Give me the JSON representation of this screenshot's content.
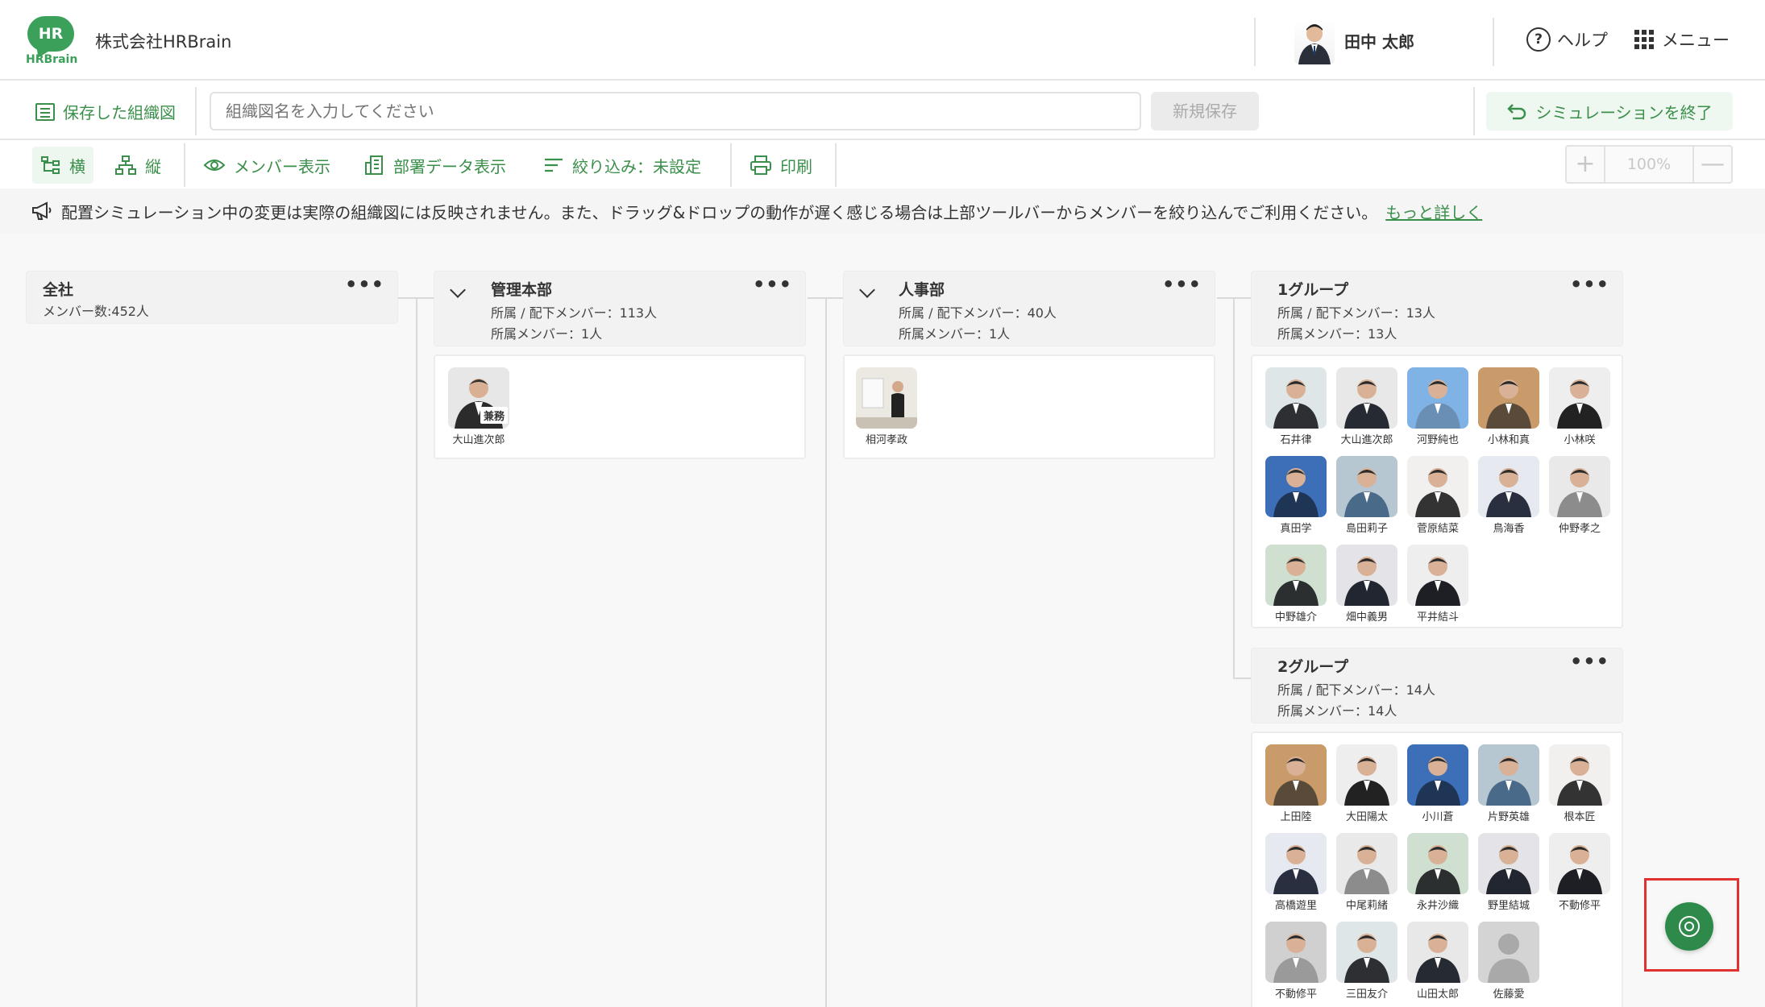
{
  "header": {
    "logo_text": "HR",
    "logo_brand": "HRBrain",
    "company": "株式会社HRBrain",
    "user_name": "田中 太郎",
    "help_label": "ヘルプ",
    "menu_label": "メニュー"
  },
  "savebar": {
    "saved_label": "保存した組織図",
    "name_placeholder": "組織図名を入力してください",
    "new_save": "新規保存",
    "end_sim": "シミュレーションを終了"
  },
  "toolbar": {
    "horizontal": "横",
    "vertical": "縦",
    "member_view": "メンバー表示",
    "dept_data": "部署データ表示",
    "filter": "絞り込み：未設定",
    "print": "印刷",
    "zoom_plus": "+",
    "zoom_value": "100%",
    "zoom_minus": "—"
  },
  "notice": {
    "text": "配置シミュレーション中の変更は実際の組織図には反映されません。また、ドラッグ&ドロップの動作が遅く感じる場合は上部ツールバーからメンバーを絞り込んでご利用ください。",
    "link": "もっと詳しく"
  },
  "org": {
    "company": {
      "title": "全社",
      "count": "メンバー数:452人"
    },
    "kanri": {
      "title": "管理本部",
      "total": "所属 / 配下メンバー：113人",
      "direct": "所属メンバー：1人",
      "members": [
        {
          "name": "大山進次郎",
          "badge": "兼務"
        }
      ]
    },
    "jinji": {
      "title": "人事部",
      "total": "所属 / 配下メンバー：40人",
      "direct": "所属メンバー：1人",
      "members": [
        {
          "name": "相河孝政"
        }
      ]
    },
    "g1": {
      "title": "1グループ",
      "total": "所属 / 配下メンバー：13人",
      "direct": "所属メンバー：13人",
      "members": [
        {
          "name": "石井律"
        },
        {
          "name": "大山進次郎"
        },
        {
          "name": "河野純也"
        },
        {
          "name": "小林和真"
        },
        {
          "name": "小林咲"
        },
        {
          "name": "真田学"
        },
        {
          "name": "島田莉子"
        },
        {
          "name": "菅原結菜"
        },
        {
          "name": "鳥海香"
        },
        {
          "name": "仲野孝之"
        },
        {
          "name": "中野雄介"
        },
        {
          "name": "畑中義男"
        },
        {
          "name": "平井結斗"
        }
      ]
    },
    "g2": {
      "title": "2グループ",
      "total": "所属 / 配下メンバー：14人",
      "direct": "所属メンバー：14人",
      "members": [
        {
          "name": "上田陸"
        },
        {
          "name": "大田陽太"
        },
        {
          "name": "小川蒼"
        },
        {
          "name": "片野英雄"
        },
        {
          "name": "根本匠"
        },
        {
          "name": "高橋遊里"
        },
        {
          "name": "中尾莉緒"
        },
        {
          "name": "永井沙織"
        },
        {
          "name": "野里結城"
        },
        {
          "name": "不動修平"
        },
        {
          "name": "不動修平"
        },
        {
          "name": "三田友介"
        },
        {
          "name": "山田太郎"
        },
        {
          "name": "佐藤愛"
        }
      ]
    }
  },
  "colors": {
    "brand": "#3aa05a",
    "accent": "#3a8f4a",
    "fab": "#2e8a4a",
    "highlight": "#e03030"
  },
  "icons": {
    "fab": "user-circle-icon"
  }
}
